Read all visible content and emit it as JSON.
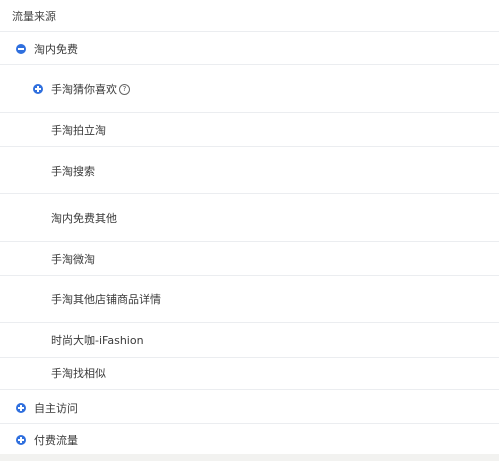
{
  "title": "流量来源",
  "groups": [
    {
      "label": "淘内免费",
      "expanded": true,
      "children": [
        {
          "label": "手淘猜你喜欢",
          "expandable": true,
          "help": "?"
        },
        {
          "label": "手淘拍立淘"
        },
        {
          "label": "手淘搜索"
        },
        {
          "label": "淘内免费其他"
        },
        {
          "label": "手淘微淘"
        },
        {
          "label": "手淘其他店铺商品详情"
        },
        {
          "label": "时尚大咖-iFashion"
        },
        {
          "label": "手淘找相似"
        }
      ]
    },
    {
      "label": "自主访问",
      "expanded": false
    },
    {
      "label": "付费流量",
      "expanded": false
    }
  ],
  "colors": {
    "toggle": "#2f6fde",
    "separator": "#ebedf0"
  },
  "icons": {
    "expanded": "minus-circle-icon",
    "collapsed": "plus-circle-icon",
    "help": "question-circle-icon"
  }
}
